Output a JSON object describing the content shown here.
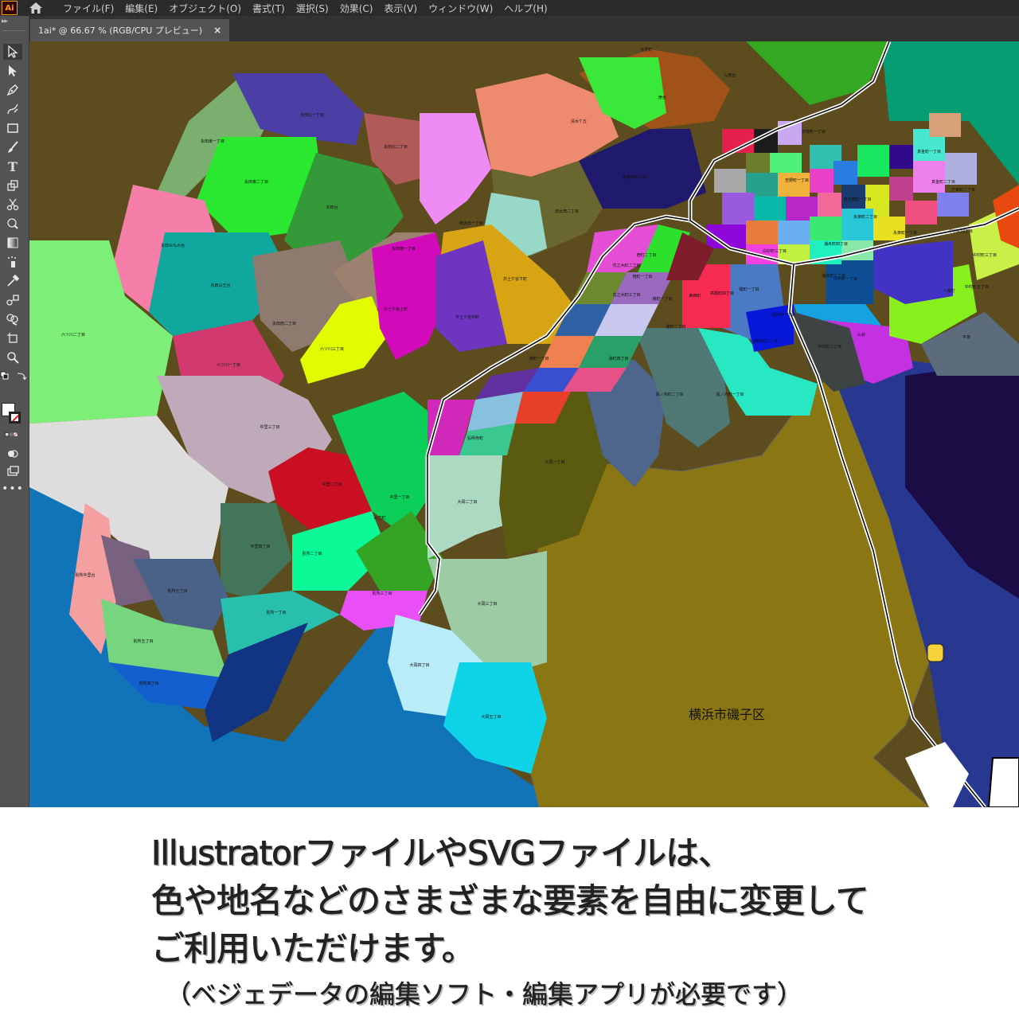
{
  "app": {
    "logo": "Ai"
  },
  "menu": [
    "ファイル(F)",
    "編集(E)",
    "オブジェクト(O)",
    "書式(T)",
    "選択(S)",
    "効果(C)",
    "表示(V)",
    "ウィンドウ(W)",
    "ヘルプ(H)"
  ],
  "document_tab": {
    "title": "1ai* @ 66.67 % (RGB/CPU プレビュー)",
    "close": "×"
  },
  "tools": [
    "selection-tool-icon",
    "direct-selection-tool-icon",
    "pen-tool-icon",
    "curvature-tool-icon",
    "rectangle-tool-icon",
    "paintbrush-tool-icon",
    "type-tool-icon",
    "free-transform-tool-icon",
    "scissors-tool-icon",
    "warp-tool-icon",
    "gradient-tool-icon",
    "symbol-sprayer-tool-icon",
    "eyedropper-tool-icon",
    "blend-tool-icon",
    "shape-builder-tool-icon",
    "artboard-tool-icon",
    "zoom-tool-icon"
  ],
  "colors": {
    "menubar": "#2b2b2b",
    "toolbar": "#535353",
    "sea": "#1173b8",
    "isogo": "#8a7612",
    "district_labels": "#111111"
  },
  "map": {
    "district_labels": [
      "永田北一丁目",
      "永田北二丁目",
      "永田東一丁目",
      "永田東二丁目",
      "永田台",
      "永田みなみ台",
      "永田山王台",
      "永田南一丁目",
      "永田南二丁目",
      "六ツ川三丁目",
      "六ツ川一丁目",
      "六ツ川二丁目",
      "井土ケ谷上町",
      "井土ケ谷中町",
      "井土ケ谷下町",
      "南太田一丁目",
      "南太田二丁目",
      "南太田四丁目",
      "清水ケ丘",
      "庚台",
      "三春台",
      "伏見町",
      "中里一丁目",
      "中里二丁目",
      "中里三丁目",
      "中里四丁目",
      "別所一丁目",
      "別所二丁目",
      "別所三丁目",
      "別所四丁目",
      "別所五丁目",
      "別所七丁目",
      "別所中里台",
      "大岡一丁目",
      "大岡二丁目",
      "大岡三丁目",
      "大岡四丁目",
      "大岡五丁目",
      "弘明寺町",
      "通町一丁目",
      "通町四丁目",
      "山王町",
      "中村町一丁目",
      "中村町二丁目",
      "中村町三丁目",
      "中村町四丁目",
      "中村町五丁目",
      "八幡町",
      "平楽",
      "山谷",
      "睦町一丁目",
      "睦町二丁目",
      "堀ノ内町二丁目",
      "堀ノ内町一丁目",
      "榎町一丁目",
      "蒔田町",
      "宿町一丁目",
      "宿町二丁目",
      "浦舟町一丁目",
      "浦舟町二丁目",
      "浦舟町三丁目",
      "浦舟町四丁目",
      "真金町一丁目",
      "真金町二丁目",
      "永楽町一丁目",
      "永楽町二丁目",
      "万世町二丁目",
      "日枝町一丁目",
      "花之木町二丁目",
      "花之木町三丁目",
      "吉野町一丁目",
      "南吉田町一丁目",
      "高根町四丁目",
      "白妙町三丁目"
    ],
    "ward_label": "横浜市磯子区"
  },
  "caption": {
    "line1": "IllustratorファイルやSVGファイルは、",
    "line2": "色や地名などのさまざまな要素を自由に変更して",
    "line3": "ご利用いただけます。",
    "line4": "（ベジェデータの編集ソフト・編集アプリが必要です）"
  }
}
